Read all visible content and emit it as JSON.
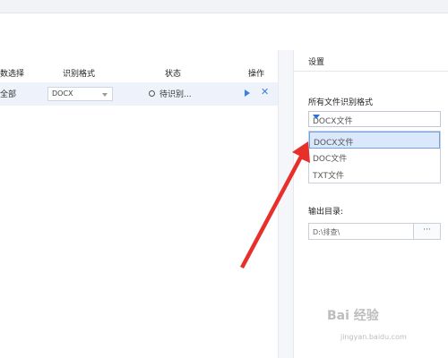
{
  "table": {
    "headers": [
      "数选择",
      "识别格式",
      "状态",
      "操作"
    ],
    "rows": [
      {
        "scope": "全部",
        "format": "DOCX",
        "status": "待识别..."
      }
    ]
  },
  "settings": {
    "title": "设置",
    "format_label": "所有文件识别格式",
    "format_selected": "DOCX文件",
    "format_options": [
      "DOCX文件",
      "DOC文件",
      "TXT文件"
    ],
    "output_label": "输出目录:",
    "output_path": "D:\\排查\\",
    "browse_label": "···"
  },
  "watermark": {
    "text": "Bai 经验",
    "url": "jingyan.baidu.com"
  },
  "colors": {
    "accent": "#3b7fe0",
    "arrow": "#e8302b",
    "selected_row": "#eef3fb",
    "selected_option": "#d9e8fb"
  },
  "icons": {
    "status": "clock-icon",
    "start": "play-icon",
    "remove": "close-icon",
    "dropdown": "caret-down-icon"
  }
}
